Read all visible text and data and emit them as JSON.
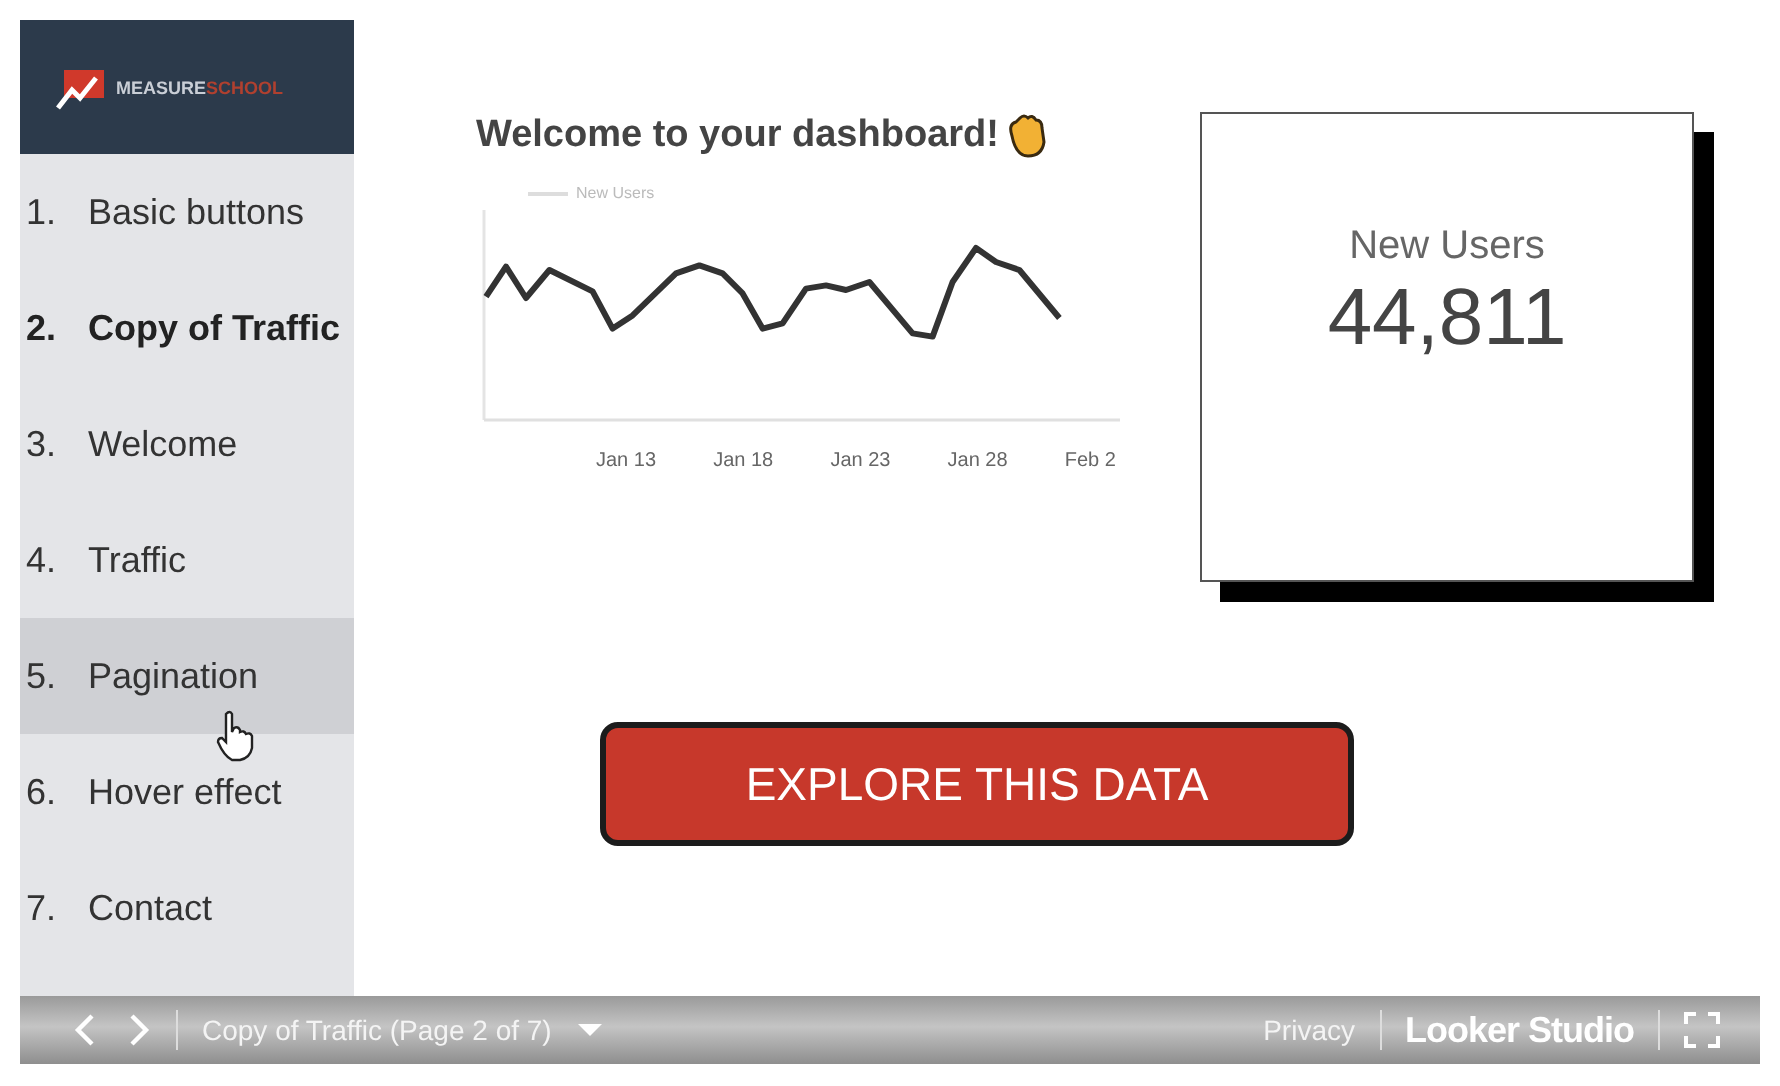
{
  "logo": {
    "primary": "MEASURE",
    "accent": "SCHOOL"
  },
  "pages": [
    {
      "number": "1.",
      "title": "Basic buttons",
      "selected": false,
      "hovered": false
    },
    {
      "number": "2.",
      "title": "Copy of Traffic",
      "selected": true,
      "hovered": false
    },
    {
      "number": "3.",
      "title": "Welcome",
      "selected": false,
      "hovered": false
    },
    {
      "number": "4.",
      "title": "Traffic",
      "selected": false,
      "hovered": false
    },
    {
      "number": "5.",
      "title": "Pagination",
      "selected": false,
      "hovered": true
    },
    {
      "number": "6.",
      "title": "Hover effect",
      "selected": false,
      "hovered": false
    },
    {
      "number": "7.",
      "title": "Contact",
      "selected": false,
      "hovered": false
    }
  ],
  "heading": "Welcome to your dashboard!",
  "chart": {
    "legend": "New Users",
    "x_labels": [
      "Jan 13",
      "Jan 18",
      "Jan 23",
      "Jan 28",
      "Feb 2"
    ]
  },
  "scorecard": {
    "label": "New Users",
    "value": "44,811"
  },
  "cta_button": "EXPLORE THIS DATA",
  "footer": {
    "page_label": "Copy of Traffic (Page 2 of 7)",
    "privacy": "Privacy",
    "brand": "Looker Studio"
  }
}
